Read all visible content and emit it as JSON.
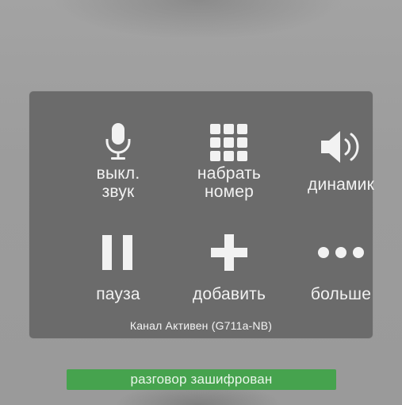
{
  "call_controls": {
    "mute": {
      "label_line1": "выкл.",
      "label_line2": "звук",
      "icon": "microphone-icon"
    },
    "keypad": {
      "label_line1": "набрать",
      "label_line2": "номер",
      "icon": "keypad-icon"
    },
    "speaker": {
      "label": "динамик",
      "icon": "speaker-icon"
    },
    "hold": {
      "label": "пауза",
      "icon": "pause-icon"
    },
    "add_call": {
      "label": "добавить",
      "icon": "plus-icon"
    },
    "more": {
      "label": "больше",
      "icon": "more-dots-icon"
    }
  },
  "channel_status": "Канал Активен (G711a-NB)",
  "encryption_status": "разговор зашифрован",
  "colors": {
    "panel": "#6b6b6b",
    "icon": "#f2f2f2",
    "encryption_bar": "#46a34e"
  }
}
